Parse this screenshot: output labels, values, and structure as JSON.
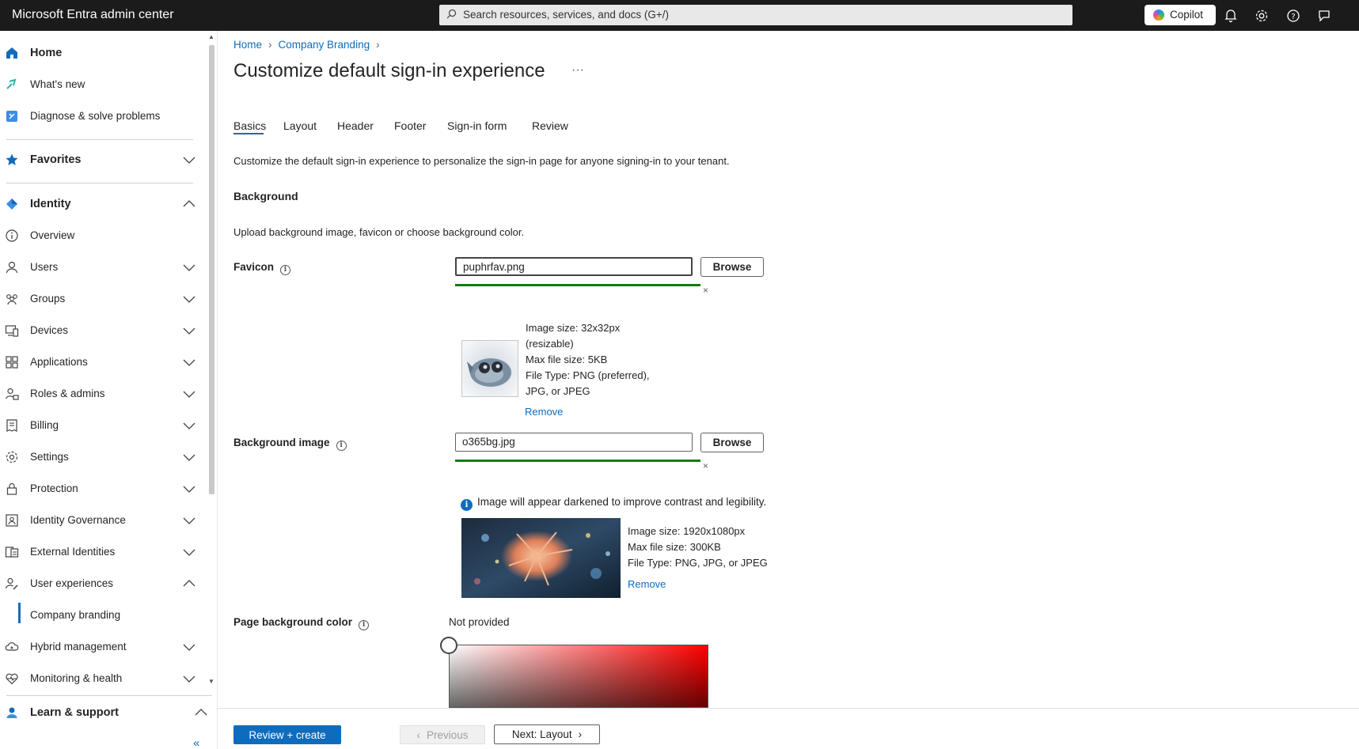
{
  "app": {
    "title": "Microsoft Entra admin center"
  },
  "topbar": {
    "search_placeholder": "Search resources, services, and docs (G+/)",
    "copilot_label": "Copilot",
    "icons": [
      "search-icon",
      "bell-icon",
      "gear-icon",
      "help-icon",
      "feedback-icon"
    ]
  },
  "sidebar": {
    "top_items": [
      {
        "label": "Home",
        "icon": "home-icon"
      },
      {
        "label": "What's new",
        "icon": "whats-new-icon"
      },
      {
        "label": "Diagnose & solve problems",
        "icon": "diagnose-icon"
      }
    ],
    "favorites": {
      "label": "Favorites",
      "icon": "star-icon"
    },
    "identity": {
      "label": "Identity",
      "icon": "identity-icon"
    },
    "identity_items": [
      {
        "label": "Overview",
        "icon": "info-icon",
        "expandable": false
      },
      {
        "label": "Users",
        "icon": "user-icon",
        "expandable": true
      },
      {
        "label": "Groups",
        "icon": "groups-icon",
        "expandable": true
      },
      {
        "label": "Devices",
        "icon": "devices-icon",
        "expandable": true
      },
      {
        "label": "Applications",
        "icon": "applications-icon",
        "expandable": true
      },
      {
        "label": "Roles & admins",
        "icon": "roles-icon",
        "expandable": true
      },
      {
        "label": "Billing",
        "icon": "billing-icon",
        "expandable": true
      },
      {
        "label": "Settings",
        "icon": "settings-icon",
        "expandable": true
      },
      {
        "label": "Protection",
        "icon": "lock-icon",
        "expandable": true
      },
      {
        "label": "Identity Governance",
        "icon": "governance-icon",
        "expandable": true
      },
      {
        "label": "External Identities",
        "icon": "external-icon",
        "expandable": true
      },
      {
        "label": "User experiences",
        "icon": "user-experiences-icon",
        "expandable": true,
        "expanded": true
      }
    ],
    "sub_item": {
      "label": "Company branding"
    },
    "more_items": [
      {
        "label": "Hybrid management",
        "icon": "hybrid-icon"
      },
      {
        "label": "Monitoring & health",
        "icon": "monitoring-icon"
      }
    ],
    "learn": {
      "label": "Learn & support",
      "icon": "learn-icon"
    },
    "collapse_label": "«"
  },
  "breadcrumb": {
    "home": "Home",
    "company_branding": "Company Branding"
  },
  "page": {
    "title": "Customize default sign-in experience",
    "more_label": "···",
    "tabs": [
      "Basics",
      "Layout",
      "Header",
      "Footer",
      "Sign-in form",
      "Review"
    ],
    "active_tab": "Basics",
    "description": "Customize the default sign-in experience to personalize the sign-in page for anyone signing-in to your tenant."
  },
  "background": {
    "heading": "Background",
    "description": "Upload background image, favicon or choose background color.",
    "favicon": {
      "label": "Favicon",
      "value": "puphrfav.png",
      "browse_label": "Browse",
      "upload_progress": 1.0,
      "clear_label": "×",
      "meta": [
        "Image size: 32x32px",
        "(resizable)",
        "Max file size: 5KB",
        "File Type: PNG (preferred),",
        "JPG, or JPEG"
      ],
      "remove_label": "Remove"
    },
    "background_image": {
      "label": "Background image",
      "value": "o365bg.jpg",
      "browse_label": "Browse",
      "upload_progress": 1.0,
      "clear_label": "×",
      "info_note": "Image will appear darkened to improve contrast and legibility.",
      "meta": [
        "Image size: 1920x1080px",
        "Max file size: 300KB",
        "File Type: PNG, JPG, or JPEG"
      ],
      "remove_label": "Remove"
    },
    "page_bg_color": {
      "label": "Page background color",
      "value": "Not provided",
      "picker_hue": "#ff0000"
    }
  },
  "footer": {
    "review_create": "Review + create",
    "previous": "Previous",
    "next": "Next: Layout"
  },
  "colors": {
    "accent": "#0f6cbd",
    "topbar": "#1b1b1b",
    "success": "#107c10"
  }
}
